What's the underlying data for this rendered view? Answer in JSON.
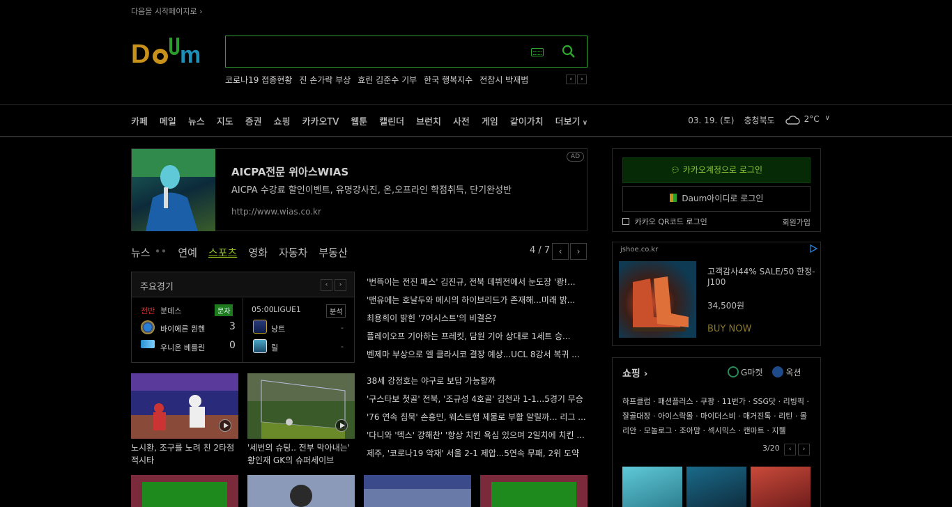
{
  "top": {
    "start_page_link": "다음을 시작페이지로 ›",
    "search_placeholder": "",
    "trending": [
      "코로나19 접종현황",
      "진 손가락 부상",
      "효린 김준수 기부",
      "한국 행복지수",
      "전참시 박재범"
    ]
  },
  "gnb": {
    "items": [
      "카페",
      "메일",
      "뉴스",
      "지도",
      "증권",
      "쇼핑",
      "카카오TV",
      "웹툰",
      "캘린더",
      "브런치",
      "사전",
      "게임",
      "같이가치",
      "더보기"
    ],
    "date": "03. 19. (토)",
    "region": "충청북도",
    "temperature": "2°C"
  },
  "ad_banner": {
    "title": "AICPA전문 위아스WIAS",
    "description": "AICPA 수강료 할인이벤트, 유명강사진, 온,오프라인 학점취득, 단기완성반",
    "url": "http://www.wias.co.kr",
    "badge": "AD"
  },
  "news": {
    "tabs": [
      "뉴스",
      "연예",
      "스포츠",
      "영화",
      "자동차",
      "부동산"
    ],
    "dots": "••",
    "active_tab": "스포츠",
    "pager": "4 / 7",
    "score": {
      "title": "주요경기",
      "left": {
        "status": "전반",
        "league": "분데스",
        "tag": "문자",
        "team1": "바이에른 뮌헨",
        "score1": "3",
        "team2": "우니온 베를린",
        "score2": "0"
      },
      "right": {
        "time": "05:00",
        "league": "LIGUE1",
        "tag": "분석",
        "team1": "낭트",
        "score1": "-",
        "team2": "릴",
        "score2": "-"
      }
    },
    "headlines": [
      "'번뜩이는 전진 패스' 김진규, 전북 데뷔전에서 눈도장 '쾅!...",
      "'맨유에는 호날두와 메시의 하이브리드가 존재해...미래 밝...",
      "최용희이 밝힌 '7어시스트'의 비결은?",
      "플레이오프 기아하는 프레킷, 담원 기아 상대로 1세트 승...",
      "벤제마 부상으로 엘 클라시코 결장 예상...UCL 8강서 복귀 ..."
    ],
    "headlines2": [
      "38세 강정호는 야구로 보답 가능할까",
      "'구스타보 첫골' 전북, '조규성 4호골' 김천과 1-1...5경기 무승",
      "'76 연속 침묵' 손흥민, 웨스트햄 제물로 부활 알릴까... 리그 ...",
      "'다니와 '덱스' 강해찬' '항상 치킨 욕심 있으며 2일치에 치킨 ...",
      "제주, '코로나19 악재' 서울 2-1 제압...5연속 무패, 2위 도약"
    ],
    "thumbs": [
      {
        "caption": "노시환, 조구를 노려 친 2타점 적시타"
      },
      {
        "caption": "'세번의 슈팅.. 전부 막아내는' 황인재 GK의 슈퍼세이브"
      }
    ]
  },
  "login": {
    "kakao_label": "카카오계정으로 로그인",
    "daum_label": "Daum아이디로 로그인",
    "qr_label": "카카오 QR코드 로그인",
    "join_label": "회원가입"
  },
  "shop_ad": {
    "source": "jshoe.co.kr",
    "title": "고객감사44% SALE/50 한정-J100",
    "price": "34,500원",
    "cta": "BUY NOW"
  },
  "shopping": {
    "title": "쇼핑 ›",
    "gmarket": "G마켓",
    "auction": "옥션",
    "keywords": "하프클럽 · 패션플러스 · 쿠팡 · 11번가 · SSG닷 · 리빙픽 · 잘골대장 · 아이스락몰 · 마이더스비 · 매거진톡 · 리틴 · 몰리안 · 모놀로그 · 조아맘 · 섹시믹스 · 캔마트 · 지웰",
    "pager": "3/20"
  },
  "colors": {
    "accent_green": "#2f9e2f",
    "active_tab": "#8fbf1f",
    "live_red": "#e03030"
  }
}
